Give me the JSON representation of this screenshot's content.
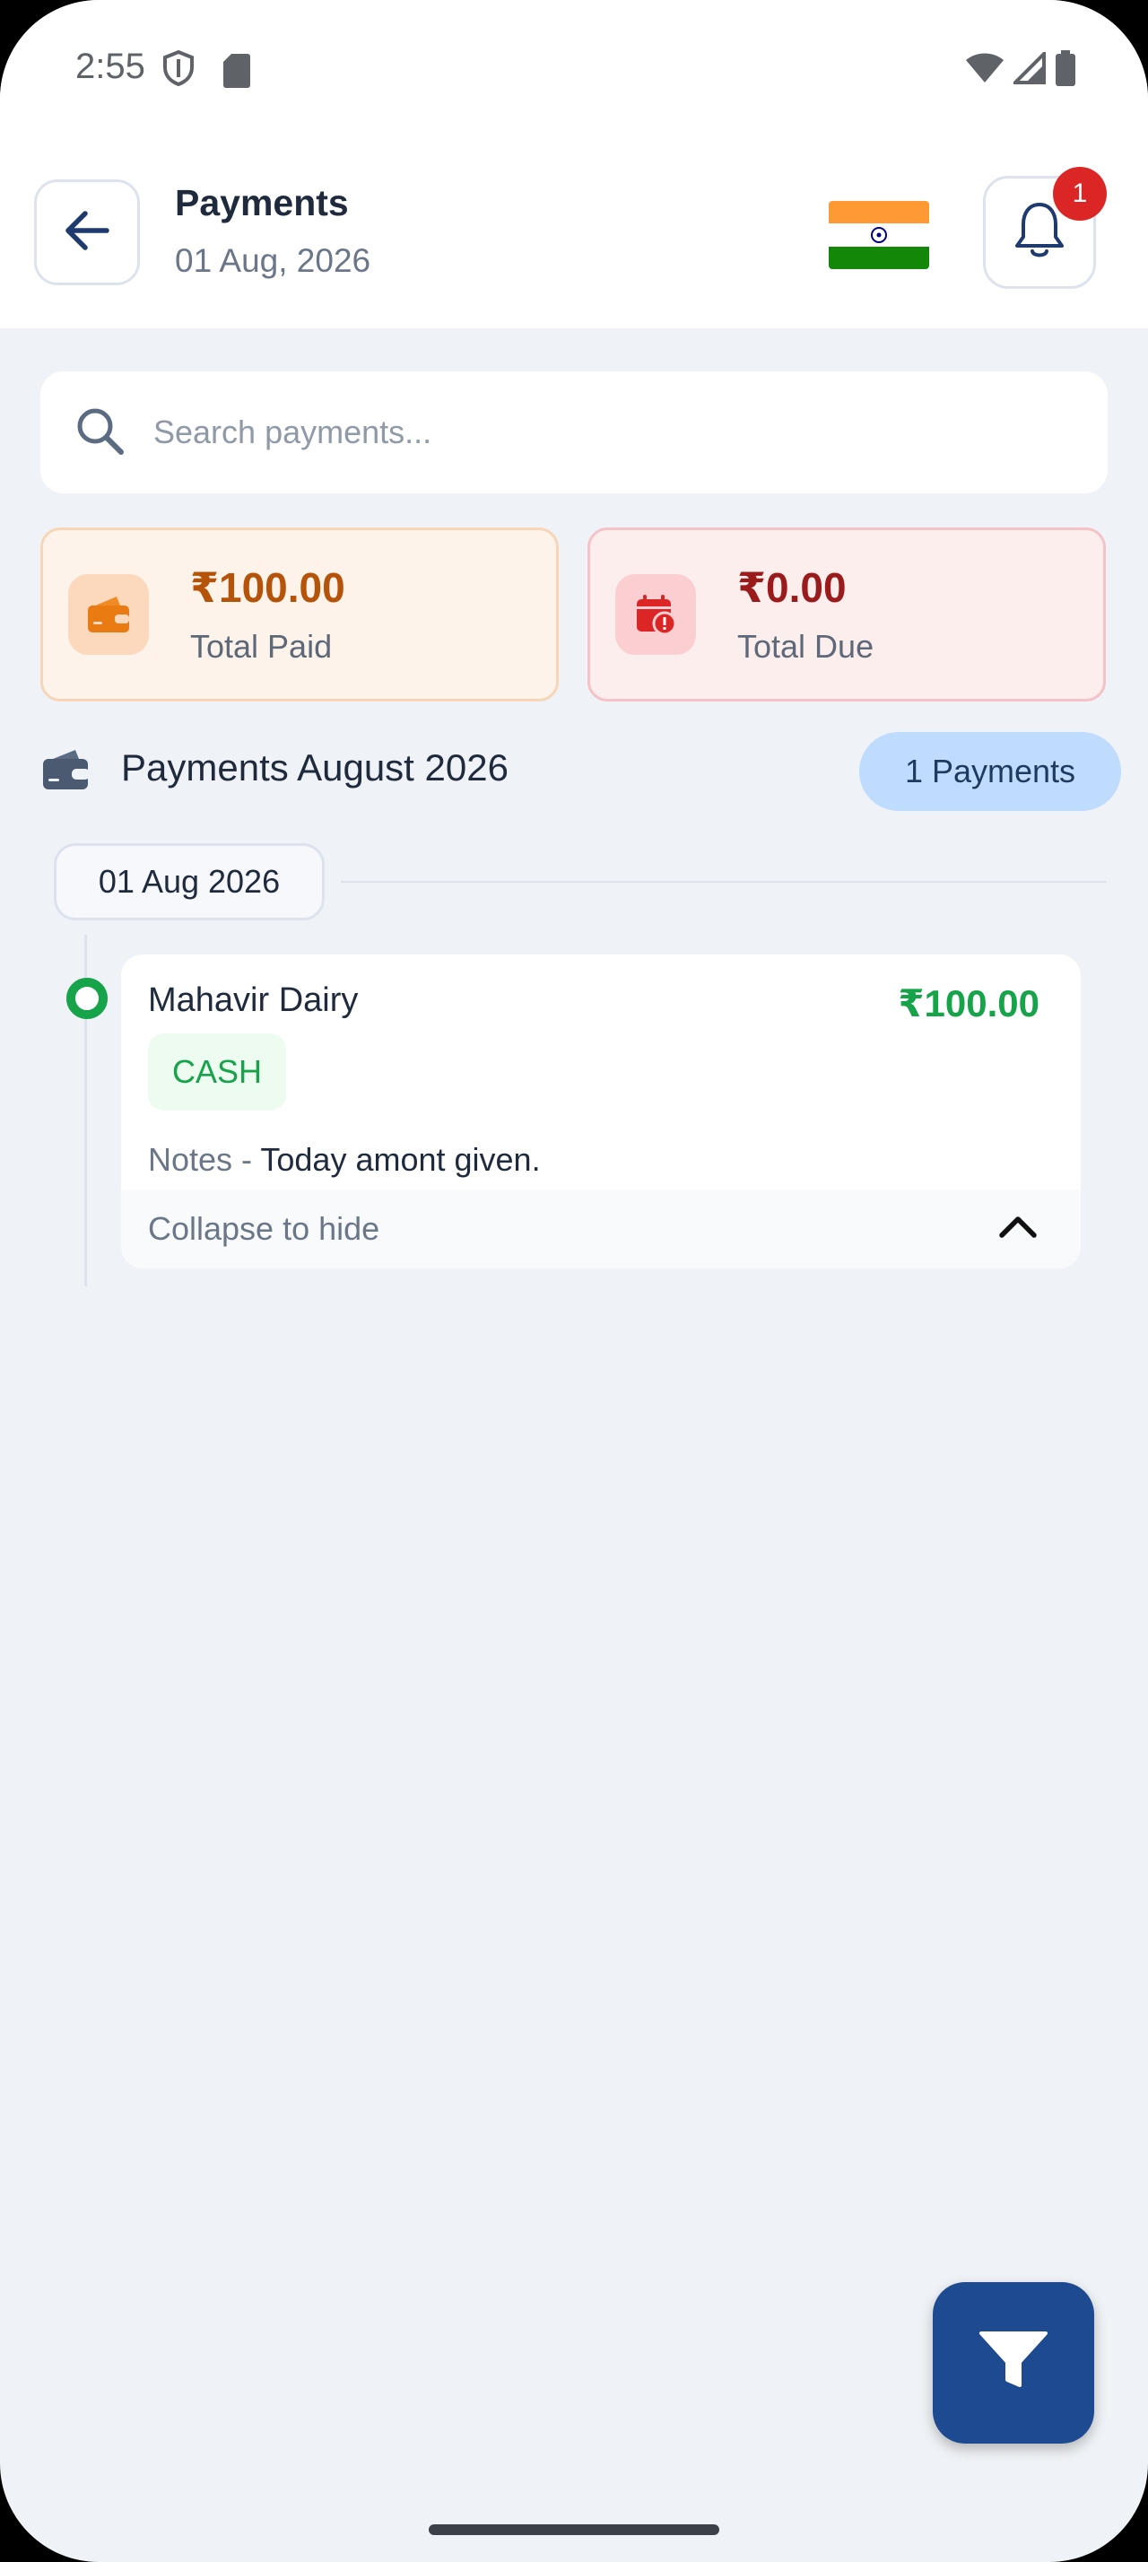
{
  "status_bar": {
    "time": "2:55"
  },
  "header": {
    "title": "Payments",
    "date": "01 Aug, 2026",
    "notification_count": "1"
  },
  "search": {
    "placeholder": "Search payments..."
  },
  "summary": {
    "paid": {
      "amount": "₹100.00",
      "label": "Total Paid"
    },
    "due": {
      "amount": "₹0.00",
      "label": "Total Due"
    }
  },
  "section": {
    "title": "Payments August 2026",
    "count": "1 Payments"
  },
  "groups": [
    {
      "date": "01 Aug 2026",
      "payments": [
        {
          "name": "Mahavir Dairy",
          "amount": "₹100.00",
          "method": "CASH",
          "notes_label": "Notes - ",
          "notes": "Today amont given.",
          "collapse_label": "Collapse to hide"
        }
      ]
    }
  ],
  "colors": {
    "accent": "#1e4a91",
    "paid": "#b45309",
    "due": "#991b1b",
    "success": "#16a34a",
    "badge": "#dc2626"
  }
}
